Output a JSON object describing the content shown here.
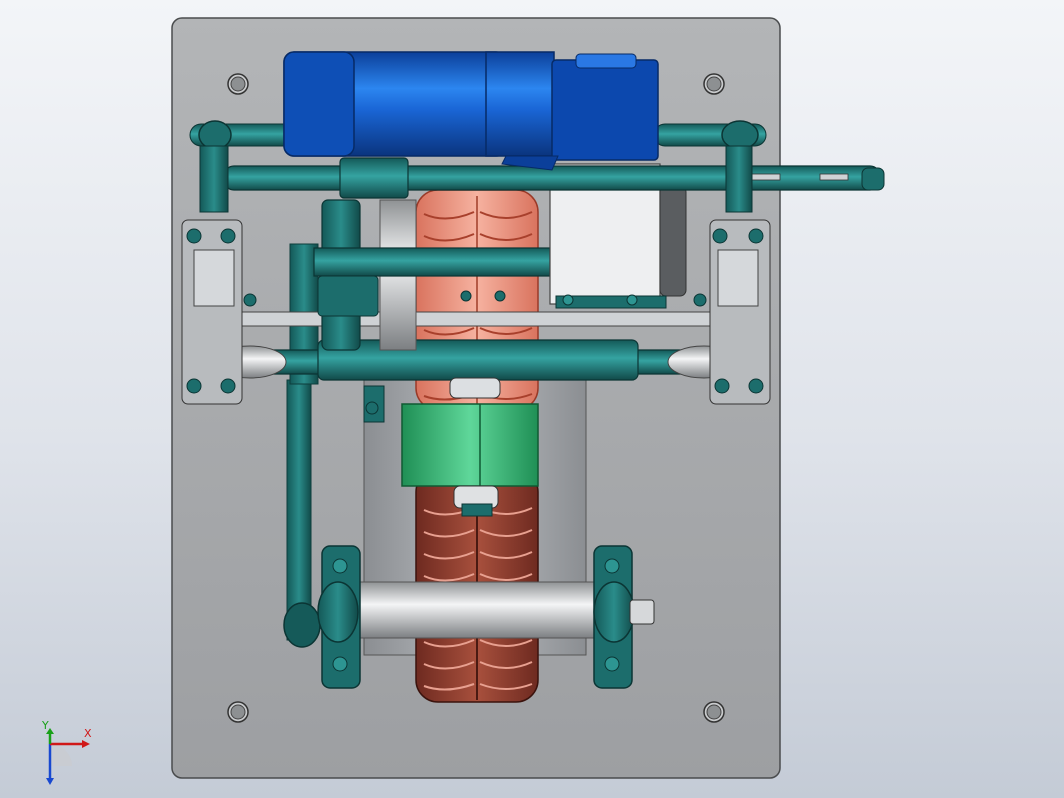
{
  "triad": {
    "x_label": "X",
    "y_label": "Y",
    "x_color": "#d01818",
    "y_color": "#18a018",
    "z_color": "#1848d0"
  },
  "colors": {
    "background_top": "#f3f5f8",
    "background_bottom": "#c4cbd6",
    "base_plate": "#a7a9ab",
    "frame_teal": "#1c6d6c",
    "motor_blue": "#1158c4",
    "tire_orange": "#e08a72",
    "tire_brown": "#8a3a2c",
    "drum_green": "#3cb878",
    "shaft_silver": "#d6d8da"
  },
  "icons": {
    "triad": "xyz-triad-icon",
    "mounting_hole": "mounting-hole-icon"
  }
}
